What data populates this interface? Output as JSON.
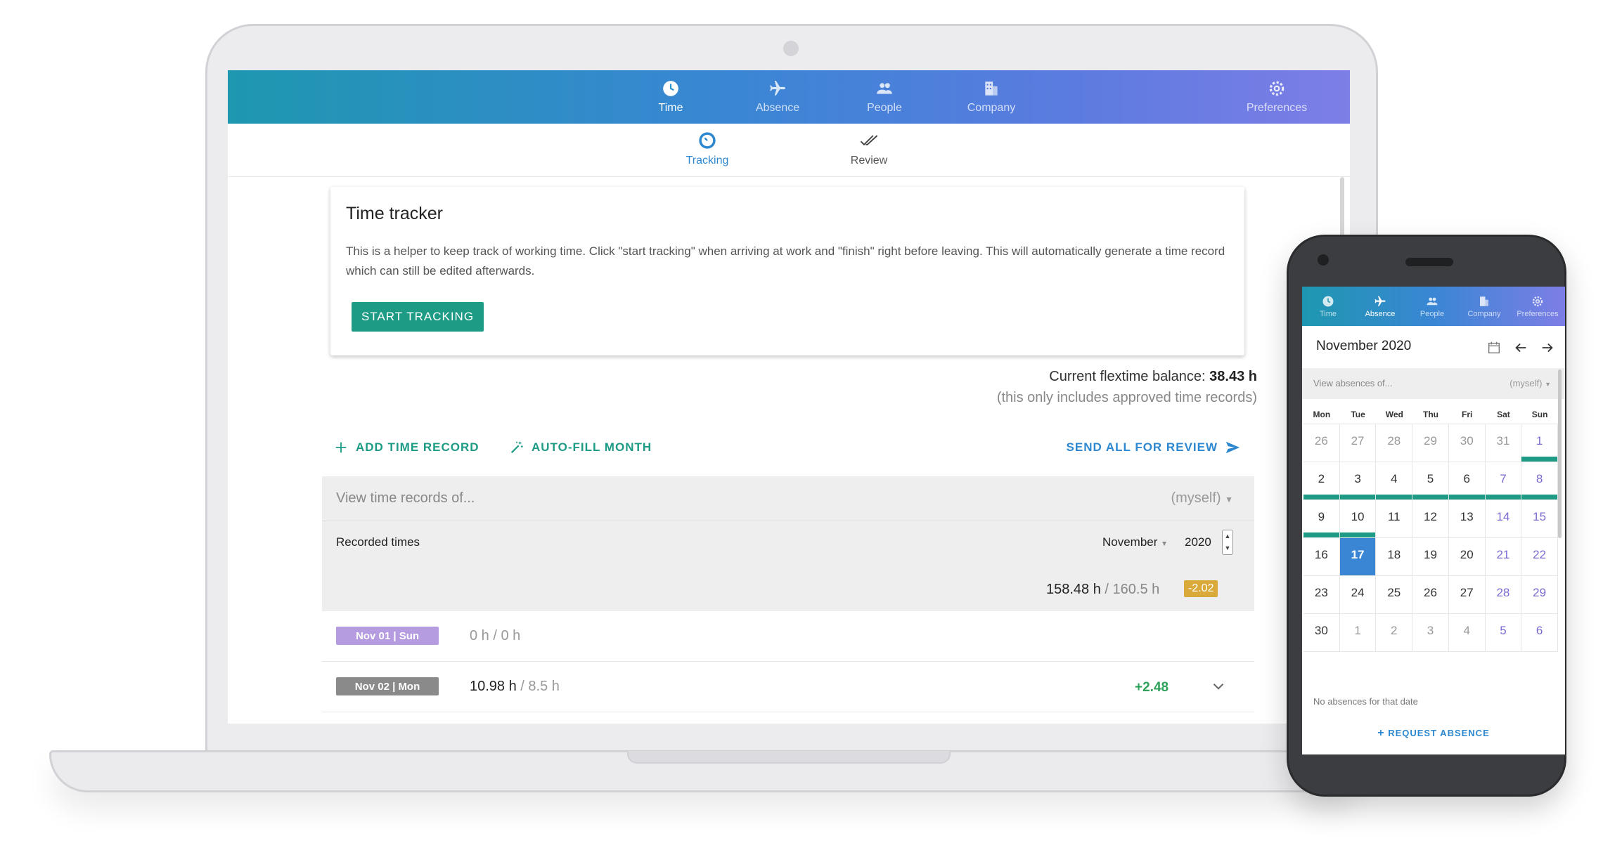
{
  "laptop": {
    "nav": [
      {
        "label": "Time",
        "icon": "clock-icon",
        "active": true
      },
      {
        "label": "Absence",
        "icon": "airplane-icon",
        "active": false
      },
      {
        "label": "People",
        "icon": "people-icon",
        "active": false
      },
      {
        "label": "Company",
        "icon": "building-icon",
        "active": false
      },
      {
        "label": "Preferences",
        "icon": "gear-icon",
        "active": false
      }
    ],
    "subnav": [
      {
        "label": "Tracking",
        "icon": "stopwatch-icon",
        "active": true
      },
      {
        "label": "Review",
        "icon": "double-check-icon",
        "active": false
      }
    ],
    "tracker": {
      "title": "Time tracker",
      "description": "This is a helper to keep track of working time. Click \"start tracking\" when arriving at work and \"finish\" right before leaving. This will automatically generate a time record which can still be edited afterwards.",
      "start_button": "START TRACKING"
    },
    "flextime": {
      "label": "Current flextime balance:",
      "value": "38.43 h",
      "note": "(this only includes approved time records)"
    },
    "actions": {
      "add": "ADD TIME RECORD",
      "autofill": "AUTO-FILL MONTH",
      "send": "SEND ALL FOR REVIEW"
    },
    "records": {
      "filter_placeholder": "View time records of...",
      "filter_value": "(myself)",
      "title": "Recorded times",
      "month": "November",
      "year": "2020",
      "sum_actual": "158.48 h",
      "sum_target": "/ 160.5 h",
      "sum_delta": "-2.02",
      "rows": [
        {
          "day": "Nov 01 | Sun",
          "actual": "0 h",
          "target": "/ 0 h",
          "delta": "",
          "tag_color": "#b59be0"
        },
        {
          "day": "Nov 02 | Mon",
          "actual": "10.98 h",
          "target": "/ 8.5 h",
          "delta": "+2.48",
          "tag_color": "#8a8a8a"
        }
      ]
    }
  },
  "phone": {
    "nav": [
      {
        "label": "Time",
        "icon": "clock-icon",
        "active": false
      },
      {
        "label": "Absence",
        "icon": "airplane-icon",
        "active": true
      },
      {
        "label": "People",
        "icon": "people-icon",
        "active": false
      },
      {
        "label": "Company",
        "icon": "building-icon",
        "active": false
      },
      {
        "label": "Preferences",
        "icon": "gear-icon",
        "active": false
      }
    ],
    "calendar": {
      "title": "November 2020",
      "filter_placeholder": "View absences of...",
      "filter_value": "(myself)",
      "weekdays": [
        "Mon",
        "Tue",
        "Wed",
        "Thu",
        "Fri",
        "Sat",
        "Sun"
      ],
      "weeks": [
        [
          {
            "d": "26",
            "other": true
          },
          {
            "d": "27",
            "other": true
          },
          {
            "d": "28",
            "other": true
          },
          {
            "d": "29",
            "other": true
          },
          {
            "d": "30",
            "other": true
          },
          {
            "d": "31",
            "other": true
          },
          {
            "d": "1",
            "weekend": true,
            "bar": true
          }
        ],
        [
          {
            "d": "2",
            "bar": true
          },
          {
            "d": "3",
            "bar": true
          },
          {
            "d": "4",
            "bar": true
          },
          {
            "d": "5",
            "bar": true
          },
          {
            "d": "6",
            "bar": true
          },
          {
            "d": "7",
            "weekend": true,
            "bar": true
          },
          {
            "d": "8",
            "weekend": true,
            "bar": true
          }
        ],
        [
          {
            "d": "9",
            "bar": true
          },
          {
            "d": "10",
            "bar": true
          },
          {
            "d": "11"
          },
          {
            "d": "12"
          },
          {
            "d": "13"
          },
          {
            "d": "14",
            "weekend": true
          },
          {
            "d": "15",
            "weekend": true
          }
        ],
        [
          {
            "d": "16"
          },
          {
            "d": "17",
            "today": true
          },
          {
            "d": "18"
          },
          {
            "d": "19"
          },
          {
            "d": "20"
          },
          {
            "d": "21",
            "weekend": true
          },
          {
            "d": "22",
            "weekend": true
          }
        ],
        [
          {
            "d": "23"
          },
          {
            "d": "24"
          },
          {
            "d": "25"
          },
          {
            "d": "26"
          },
          {
            "d": "27"
          },
          {
            "d": "28",
            "weekend": true
          },
          {
            "d": "29",
            "weekend": true
          }
        ],
        [
          {
            "d": "30"
          },
          {
            "d": "1",
            "other": true
          },
          {
            "d": "2",
            "other": true
          },
          {
            "d": "3",
            "other": true
          },
          {
            "d": "4",
            "other": true
          },
          {
            "d": "5",
            "other": true,
            "weekend": true
          },
          {
            "d": "6",
            "other": true,
            "weekend": true
          }
        ]
      ],
      "empty_text": "No absences for that date",
      "request_button": "REQUEST ABSENCE"
    }
  },
  "colors": {
    "accent_green": "#1d9b85",
    "accent_blue": "#2d88d0",
    "delta_positive": "#2da05a",
    "delta_negative_badge": "#d9a93a"
  }
}
